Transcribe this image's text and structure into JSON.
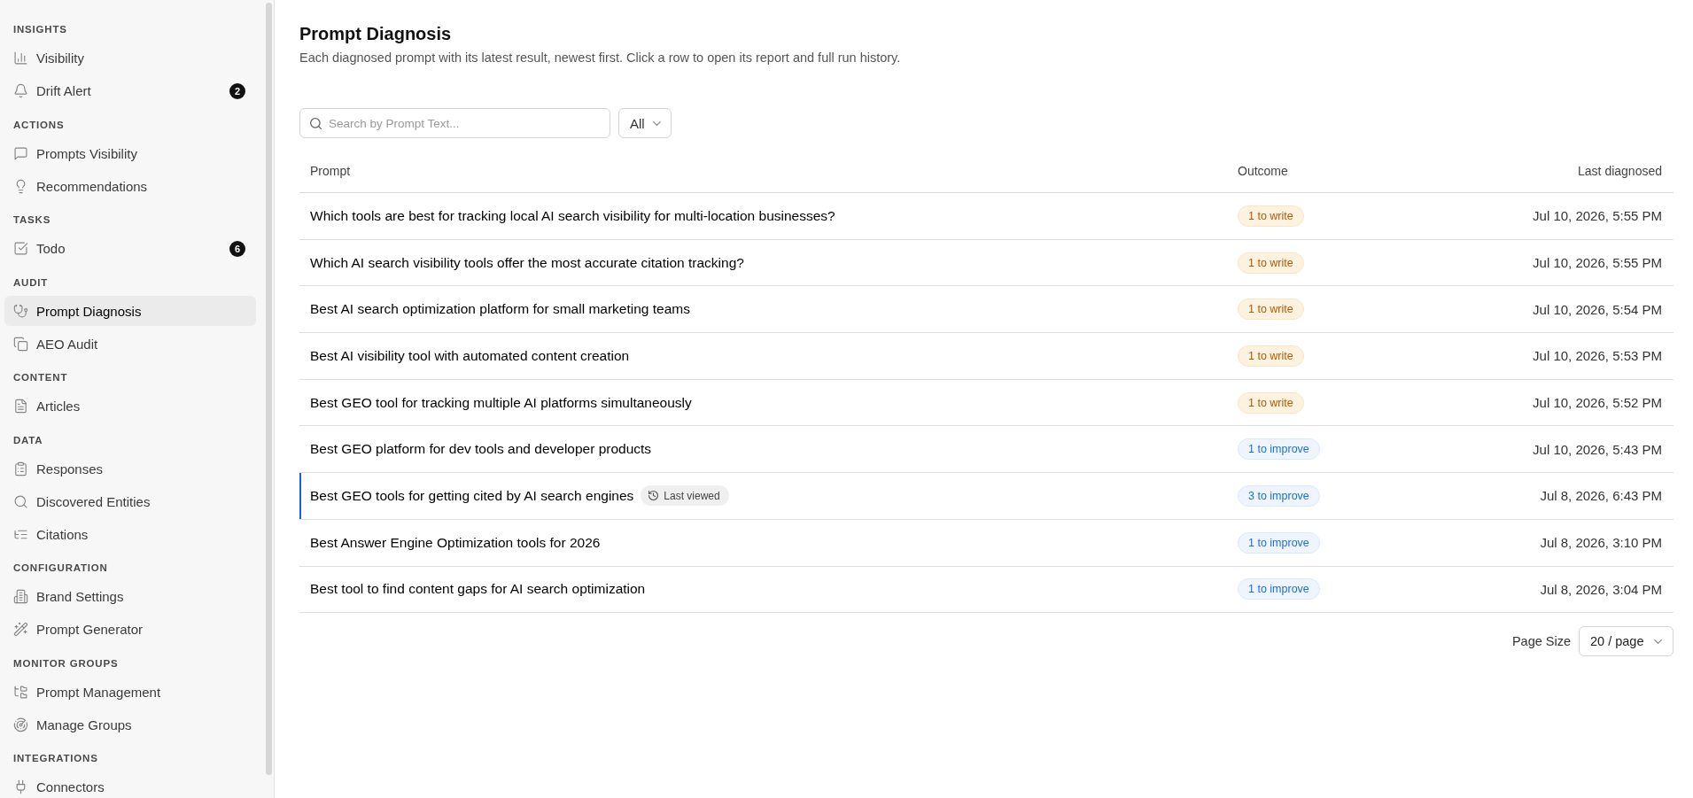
{
  "sidebar": {
    "sections": [
      {
        "title": "INSIGHTS",
        "items": [
          {
            "label": "Visibility",
            "selected": false
          },
          {
            "label": "Drift Alert",
            "selected": false,
            "badge": "2"
          }
        ]
      },
      {
        "title": "ACTIONS",
        "items": [
          {
            "label": "Prompts Visibility",
            "selected": false
          },
          {
            "label": "Recommendations",
            "selected": false
          }
        ]
      },
      {
        "title": "TASKS",
        "items": [
          {
            "label": "Todo",
            "selected": false,
            "badge": "6"
          }
        ]
      },
      {
        "title": "AUDIT",
        "items": [
          {
            "label": "Prompt Diagnosis",
            "selected": true
          },
          {
            "label": "AEO Audit",
            "selected": false
          }
        ]
      },
      {
        "title": "CONTENT",
        "items": [
          {
            "label": "Articles",
            "selected": false
          }
        ]
      },
      {
        "title": "DATA",
        "items": [
          {
            "label": "Responses",
            "selected": false
          },
          {
            "label": "Discovered Entities",
            "selected": false
          },
          {
            "label": "Citations",
            "selected": false
          }
        ]
      },
      {
        "title": "CONFIGURATION",
        "items": [
          {
            "label": "Brand Settings",
            "selected": false
          },
          {
            "label": "Prompt Generator",
            "selected": false
          }
        ]
      },
      {
        "title": "MONITOR GROUPS",
        "items": [
          {
            "label": "Prompt Management",
            "selected": false
          },
          {
            "label": "Manage Groups",
            "selected": false
          }
        ]
      },
      {
        "title": "INTEGRATIONS",
        "items": [
          {
            "label": "Connectors",
            "selected": false
          }
        ]
      }
    ]
  },
  "header": {
    "title": "Prompt Diagnosis",
    "subtitle": "Each diagnosed prompt with its latest result, newest first. Click a row to open its report and full run history."
  },
  "filters": {
    "search": {
      "placeholder": "Search by Prompt Text..."
    },
    "outcome_filter": {
      "value": "All"
    }
  },
  "table": {
    "columns": [
      "Prompt",
      "Outcome",
      "Last diagnosed"
    ],
    "rows": [
      {
        "prompt": "Which tools are best for tracking local AI search visibility for multi-location businesses?",
        "last_viewed": false,
        "outcome": {
          "label": "1 to write",
          "kind": "write"
        },
        "last_diagnosed": "Jul 10, 2026, 5:55 PM"
      },
      {
        "prompt": "Which AI search visibility tools offer the most accurate citation tracking?",
        "last_viewed": false,
        "outcome": {
          "label": "1 to write",
          "kind": "write"
        },
        "last_diagnosed": "Jul 10, 2026, 5:55 PM"
      },
      {
        "prompt": "Best AI search optimization platform for small marketing teams",
        "last_viewed": false,
        "outcome": {
          "label": "1 to write",
          "kind": "write"
        },
        "last_diagnosed": "Jul 10, 2026, 5:54 PM"
      },
      {
        "prompt": "Best AI visibility tool with automated content creation",
        "last_viewed": false,
        "outcome": {
          "label": "1 to write",
          "kind": "write"
        },
        "last_diagnosed": "Jul 10, 2026, 5:53 PM"
      },
      {
        "prompt": "Best GEO tool for tracking multiple AI platforms simultaneously",
        "last_viewed": false,
        "outcome": {
          "label": "1 to write",
          "kind": "write"
        },
        "last_diagnosed": "Jul 10, 2026, 5:52 PM"
      },
      {
        "prompt": "Best GEO platform for dev tools and developer products",
        "last_viewed": false,
        "outcome": {
          "label": "1 to improve",
          "kind": "improve"
        },
        "last_diagnosed": "Jul 10, 2026, 5:43 PM"
      },
      {
        "prompt": "Best GEO tools for getting cited by AI search engines",
        "last_viewed": true,
        "tag": "Last viewed",
        "outcome": {
          "label": "3 to improve",
          "kind": "improve"
        },
        "last_diagnosed": "Jul 8, 2026, 6:43 PM"
      },
      {
        "prompt": "Best Answer Engine Optimization tools for 2026",
        "last_viewed": false,
        "outcome": {
          "label": "1 to improve",
          "kind": "improve"
        },
        "last_diagnosed": "Jul 8, 2026, 3:10 PM"
      },
      {
        "prompt": "Best tool to find content gaps for AI search optimization",
        "last_viewed": false,
        "outcome": {
          "label": "1 to improve",
          "kind": "improve"
        },
        "last_diagnosed": "Jul 8, 2026, 3:04 PM"
      }
    ]
  },
  "pagination": {
    "label": "Page Size",
    "page_size": "20 / page"
  }
}
